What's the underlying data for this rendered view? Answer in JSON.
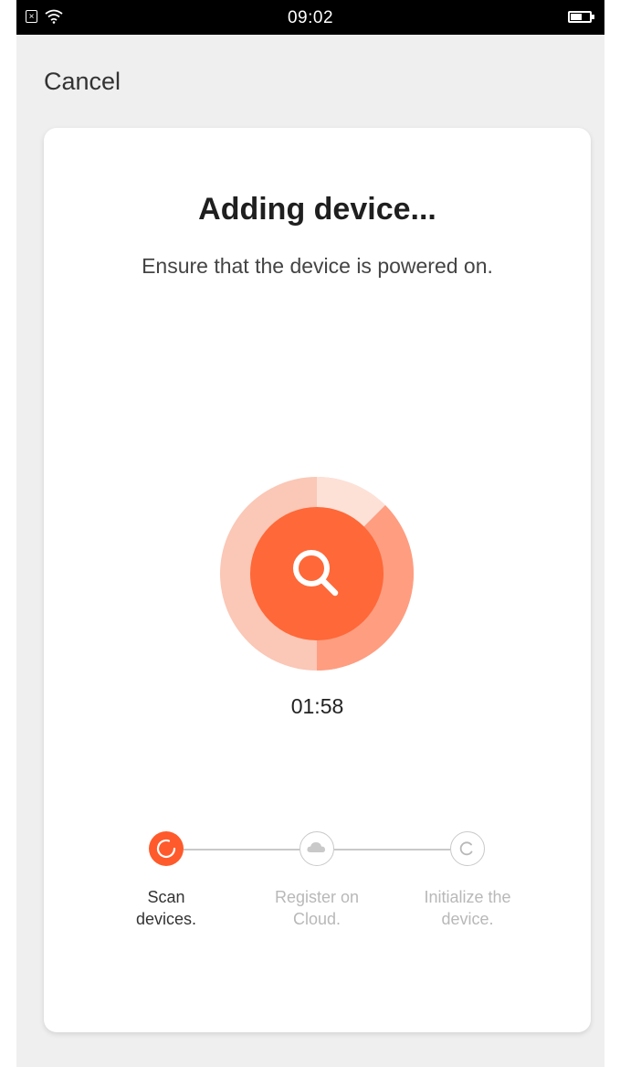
{
  "statusbar": {
    "time": "09:02",
    "icons": [
      "notification-icon",
      "wifi-icon",
      "battery-icon"
    ]
  },
  "header": {
    "cancel_label": "Cancel"
  },
  "main": {
    "title": "Adding device...",
    "subtitle": "Ensure that the device is powered on.",
    "scanner_icon": "search-icon",
    "timer": "01:58",
    "accent_color": "#ff5a2b"
  },
  "steps": [
    {
      "line1": "Scan",
      "line2": "devices.",
      "state": "active",
      "icon": "spinner-icon"
    },
    {
      "line1": "Register on",
      "line2": "Cloud.",
      "state": "inactive",
      "icon": "cloud-icon"
    },
    {
      "line1": "Initialize the",
      "line2": "device.",
      "state": "inactive",
      "icon": "refresh-icon"
    }
  ]
}
